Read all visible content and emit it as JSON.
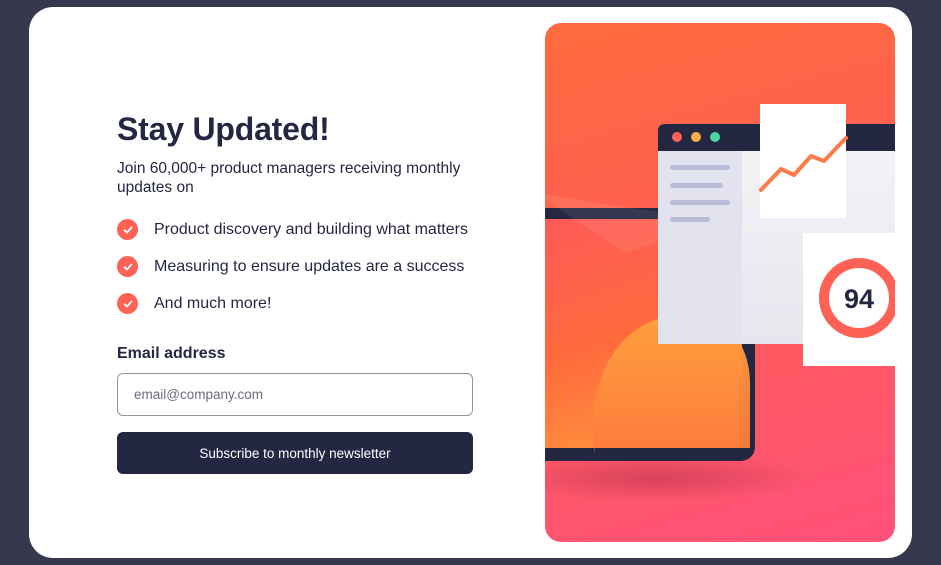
{
  "signup": {
    "title": "Stay Updated!",
    "lead": "Join 60,000+ product managers receiving monthly updates on",
    "features": [
      "Product discovery and building what matters",
      "Measuring to ensure updates are a success",
      "And much more!"
    ],
    "email_label": "Email address",
    "email_placeholder": "email@company.com",
    "email_value": "",
    "submit_label": "Subscribe to monthly newsletter"
  },
  "illustration": {
    "score": "94"
  },
  "colors": {
    "background": "#36384d",
    "card": "#ffffff",
    "text_dark": "#242742",
    "accent_tomato": "#ff6155",
    "button": "#242742",
    "illustration_gradient": [
      "#ff6b3d",
      "#ff527b"
    ]
  },
  "icons": {
    "feature_bullet": "check-icon"
  }
}
